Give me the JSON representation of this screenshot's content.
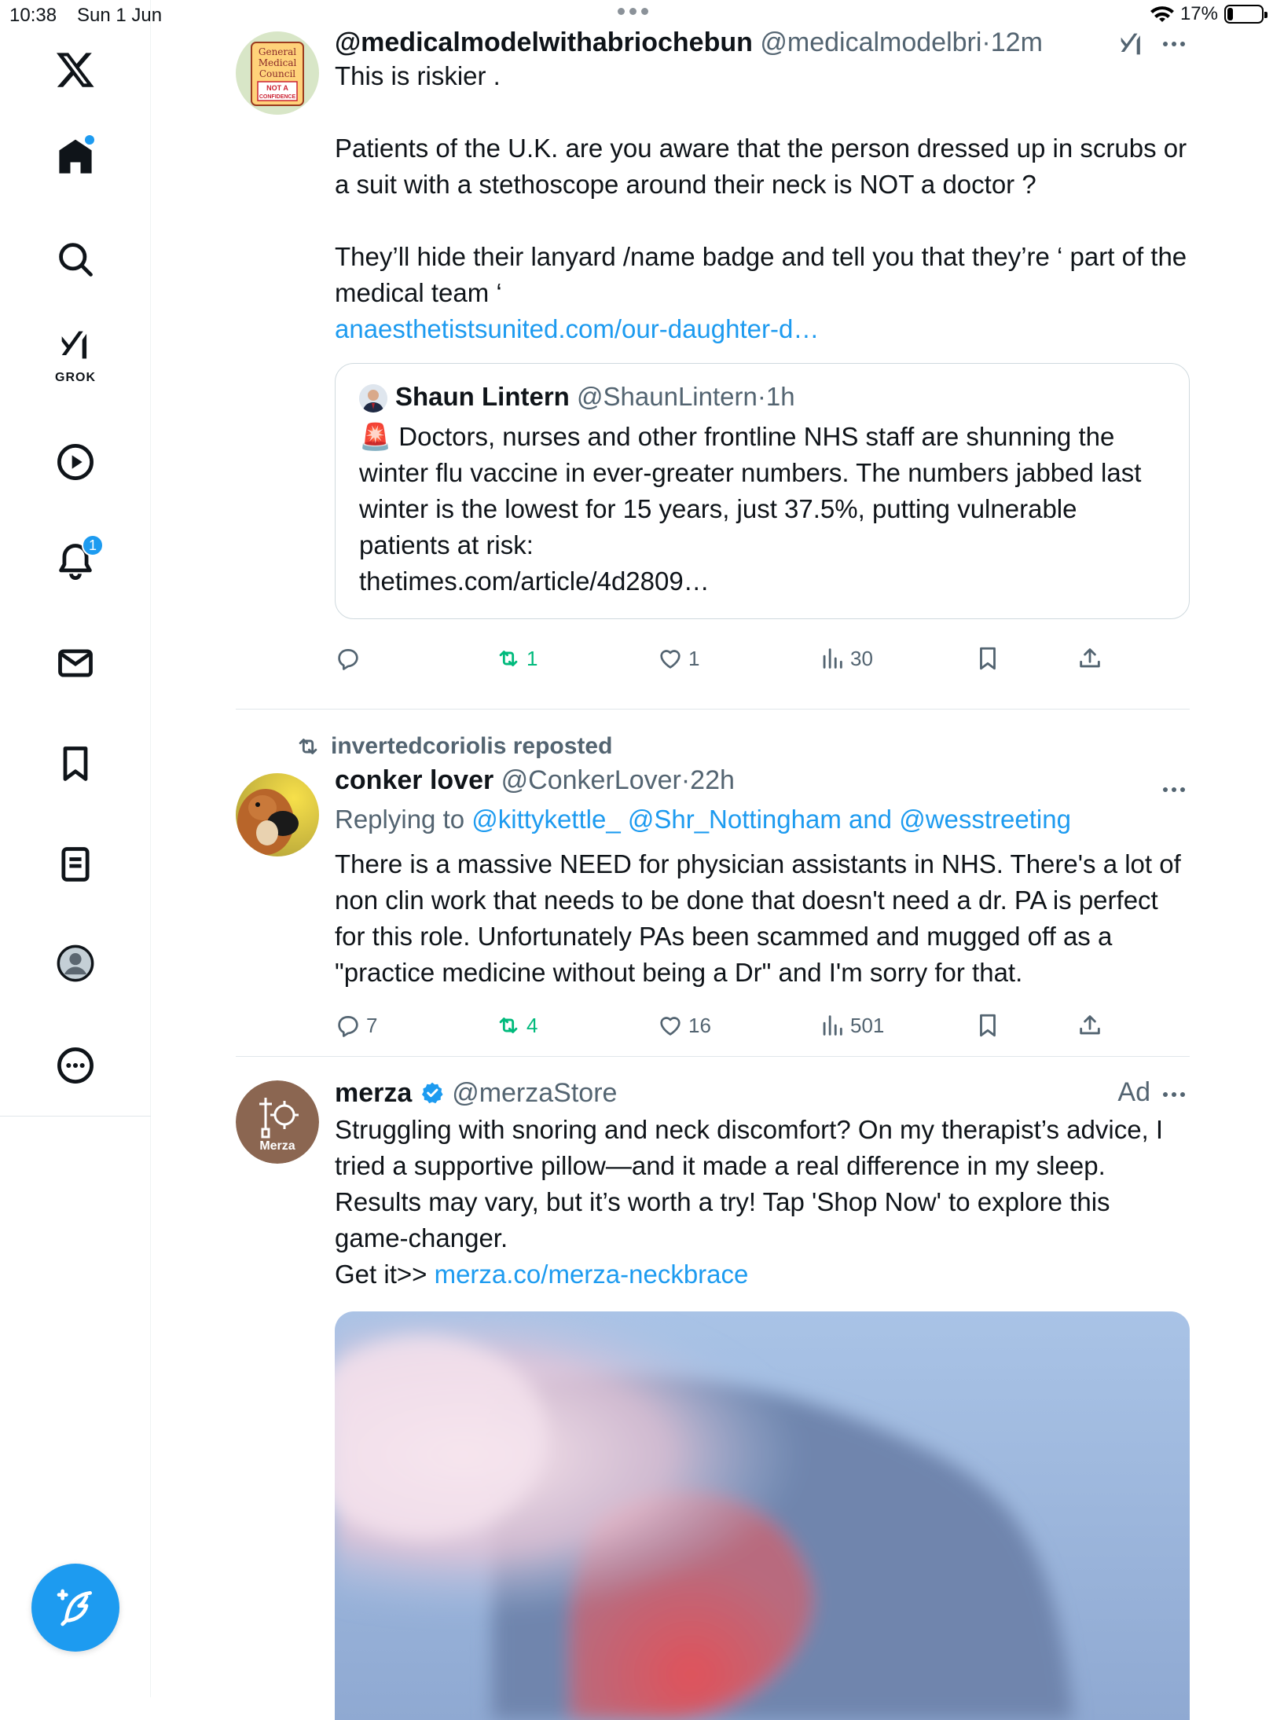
{
  "status_bar": {
    "time": "10:38",
    "date": "Sun 1 Jun",
    "battery": "17%",
    "battery_level": 0.17
  },
  "sidebar": {
    "grok_label": "GROK",
    "notifications_count": "1",
    "items": [
      "x-logo",
      "home",
      "search",
      "grok",
      "videos",
      "notifications",
      "messages",
      "bookmarks",
      "lists",
      "profile",
      "more"
    ]
  },
  "tweets": [
    {
      "name": "@medicalmodelwithabriochebun",
      "handle": "@medicalmodelbri",
      "time": "12m",
      "avatar_text": [
        "General",
        "Medical",
        "Council",
        "NOT A",
        "CONFIDENCE"
      ],
      "paragraphs": [
        "This is riskier .",
        "Patients of the U.K. are you aware that the person dressed up in scrubs or a suit with a stethoscope around their neck is NOT a doctor ?",
        "They’ll hide their lanyard /name badge and tell you that they’re ‘ part of the medical team ‘"
      ],
      "link": "anaesthetistsunited.com/our-daughter-d…",
      "quote": {
        "name": "Shaun Lintern",
        "handle": "@ShaunLintern",
        "time": "1h",
        "emoji": "🚨",
        "text": "Doctors, nurses and other frontline NHS staff are shunning the winter flu vaccine in ever-greater numbers. The numbers jabbed last winter is the lowest for 15 years, just 37.5%, putting vulnerable patients at risk:",
        "link": "thetimes.com/article/4d2809…"
      },
      "stats": {
        "replies": "",
        "reposts": "1",
        "likes": "1",
        "views": "30"
      }
    },
    {
      "reposted_by": "invertedcoriolis reposted",
      "name": "conker lover",
      "handle": "@ConkerLover",
      "time": "22h",
      "replying_prefix": "Replying to",
      "replying_to": "@kittykettle_ @Shr_Nottingham and @wesstreeting",
      "text": "There is a massive NEED for physician assistants in NHS. There's a lot of non clin work that needs to be done that doesn't need a dr.  PA is perfect for this role. Unfortunately PAs been scammed and mugged off as a \"practice medicine without being a Dr\" and I'm sorry for that.",
      "stats": {
        "replies": "7",
        "reposts": "4",
        "likes": "16",
        "views": "501"
      }
    },
    {
      "name": "merza",
      "handle": "@merzaStore",
      "ad_label": "Ad",
      "avatar_text": "Merza",
      "text": "Struggling with snoring and neck discomfort? On my therapist’s advice, I tried a supportive pillow—and it made a real difference in my sleep. Results may vary, but it’s worth a try! Tap 'Shop Now' to explore this game-changer.",
      "get_it": "Get it>>",
      "link": "merza.co/merza-neckbrace"
    }
  ],
  "colors": {
    "accent": "#1d9bf0",
    "repost_green": "#00ba7c",
    "muted": "#536471",
    "text": "#0f1419"
  }
}
